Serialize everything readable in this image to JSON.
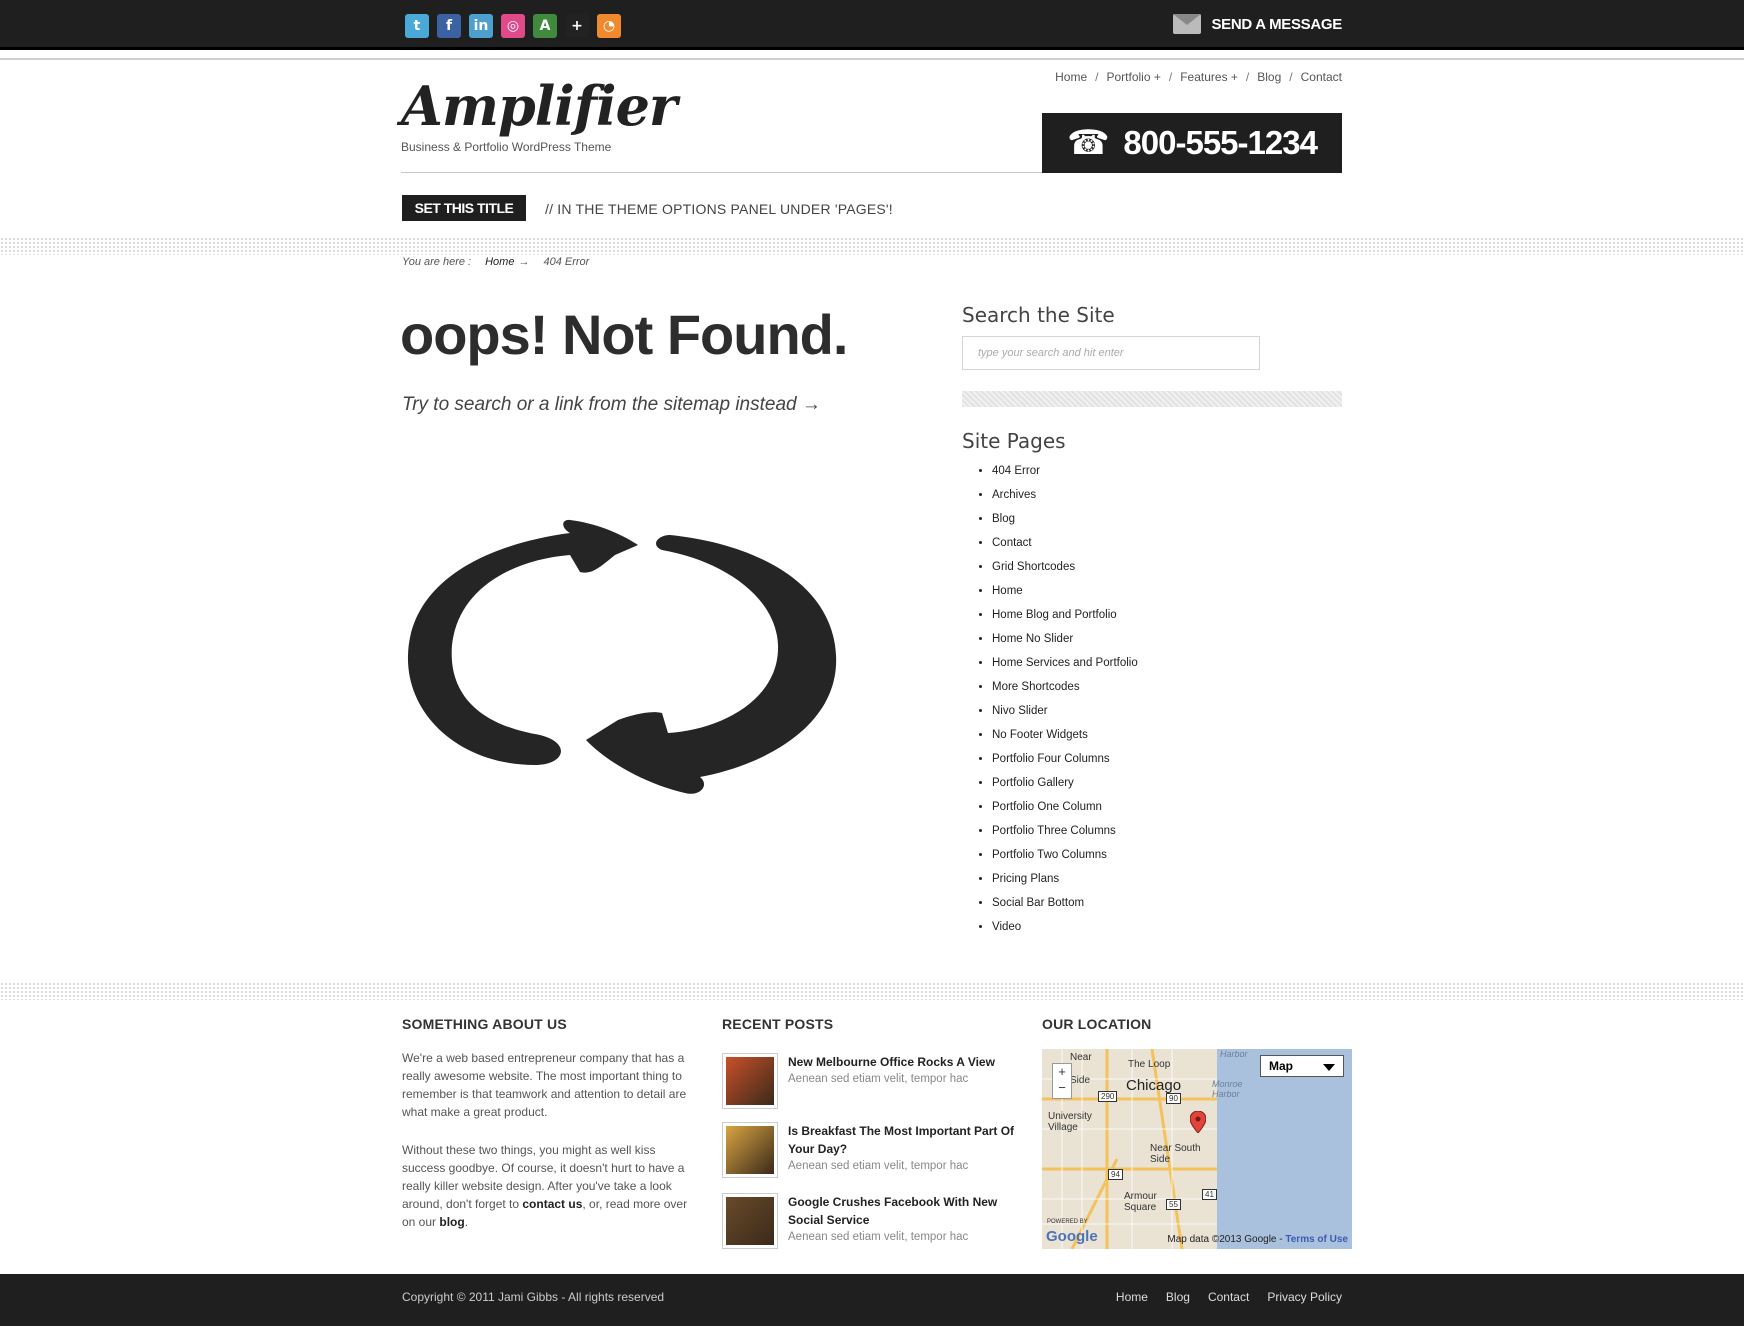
{
  "topbar": {
    "social_icons": [
      {
        "name": "twitter-icon",
        "glyph": "t",
        "color": "#4aa9d6"
      },
      {
        "name": "facebook-icon",
        "glyph": "f",
        "color": "#3b62a3"
      },
      {
        "name": "linkedin-icon",
        "glyph": "in",
        "color": "#4d9fcd"
      },
      {
        "name": "dribbble-icon",
        "glyph": "◎",
        "color": "#e04a8a"
      },
      {
        "name": "deviantart-icon",
        "glyph": "A",
        "color": "#3f8a3c"
      },
      {
        "name": "googleplus-icon",
        "glyph": "+",
        "color": "#222222"
      },
      {
        "name": "rss-icon",
        "glyph": "◔",
        "color": "#f08a2c"
      }
    ],
    "send_message": "SEND A MESSAGE"
  },
  "header": {
    "logo": "Amplifier",
    "tagline": "Business & Portfolio WordPress Theme",
    "nav": [
      "Home",
      "Portfolio +",
      "Features +",
      "Blog",
      "Contact"
    ],
    "phone": "800-555-1234",
    "phone_icon": "☎"
  },
  "titlebar": {
    "badge": "SET THIS TITLE",
    "description": "//   IN THE THEME OPTIONS PANEL UNDER 'PAGES'!"
  },
  "breadcrumb": {
    "prefix": "You are here :",
    "home": "Home",
    "arrow": "→",
    "current": "404 Error"
  },
  "main": {
    "title": "oops! Not Found.",
    "subtitle": "Try to search or a link from the sitemap instead →"
  },
  "sidebar": {
    "search_heading": "Search the Site",
    "search_placeholder": "type your search and hit enter",
    "pages_heading": "Site Pages",
    "pages": [
      "404 Error",
      "Archives",
      "Blog",
      "Contact",
      "Grid Shortcodes",
      "Home",
      "Home Blog and Portfolio",
      "Home No Slider",
      "Home Services and Portfolio",
      "More Shortcodes",
      "Nivo Slider",
      "No Footer Widgets",
      "Portfolio Four Columns",
      "Portfolio Gallery",
      "Portfolio One Column",
      "Portfolio Three Columns",
      "Portfolio Two Columns",
      "Pricing Plans",
      "Social Bar Bottom",
      "Video"
    ]
  },
  "footer": {
    "about_heading": "SOMETHING ABOUT US",
    "about_p1": "We're a web based entrepreneur company that has a really awesome website. The most important thing to remember is that teamwork and attention to detail are what make a great product.",
    "about_p2_a": "Without these two things, you might as well kiss success goodbye. Of course, it doesn't hurt to have a really killer website design. After you've take a look around, don't forget to ",
    "about_p2_contact": "contact us",
    "about_p2_b": ", or, read more over on our ",
    "about_p2_blog": "blog",
    "about_p2_end": ".",
    "recent_heading": "RECENT POSTS",
    "posts": [
      {
        "title": "New Melbourne Office Rocks A View",
        "excerpt": "Aenean sed etiam velit, tempor hac",
        "thumb_color": "#c9502a"
      },
      {
        "title": "Is Breakfast The Most Important Part Of Your Day?",
        "excerpt": "Aenean sed etiam velit, tempor hac",
        "thumb_color": "#d9a441"
      },
      {
        "title": "Google Crushes Facebook With New Social Service",
        "excerpt": "Aenean sed etiam velit, tempor hac",
        "thumb_color": "#6a4a2a"
      }
    ],
    "location_heading": "OUR LOCATION",
    "map": {
      "type_label": "Map",
      "labels": {
        "chicago": "Chicago",
        "loop": "The Loop",
        "university": "University Village",
        "near_south": "Near South Side",
        "armour": "Armour Square",
        "monroe": "Monroe Harbor",
        "harbor": "Harbor",
        "near": "Near",
        "side": "Side"
      },
      "shields": [
        "290",
        "90",
        "94",
        "55",
        "41"
      ],
      "credit": "Map data ©2013 Google -",
      "terms": "Terms of Use",
      "google": "Google",
      "powered": "POWERED BY",
      "zoom_in": "+",
      "zoom_out": "−"
    }
  },
  "bottombar": {
    "copyright": "Copyright © 2011 Jami Gibbs - All rights reserved",
    "nav": [
      "Home",
      "Blog",
      "Contact",
      "Privacy Policy"
    ]
  }
}
